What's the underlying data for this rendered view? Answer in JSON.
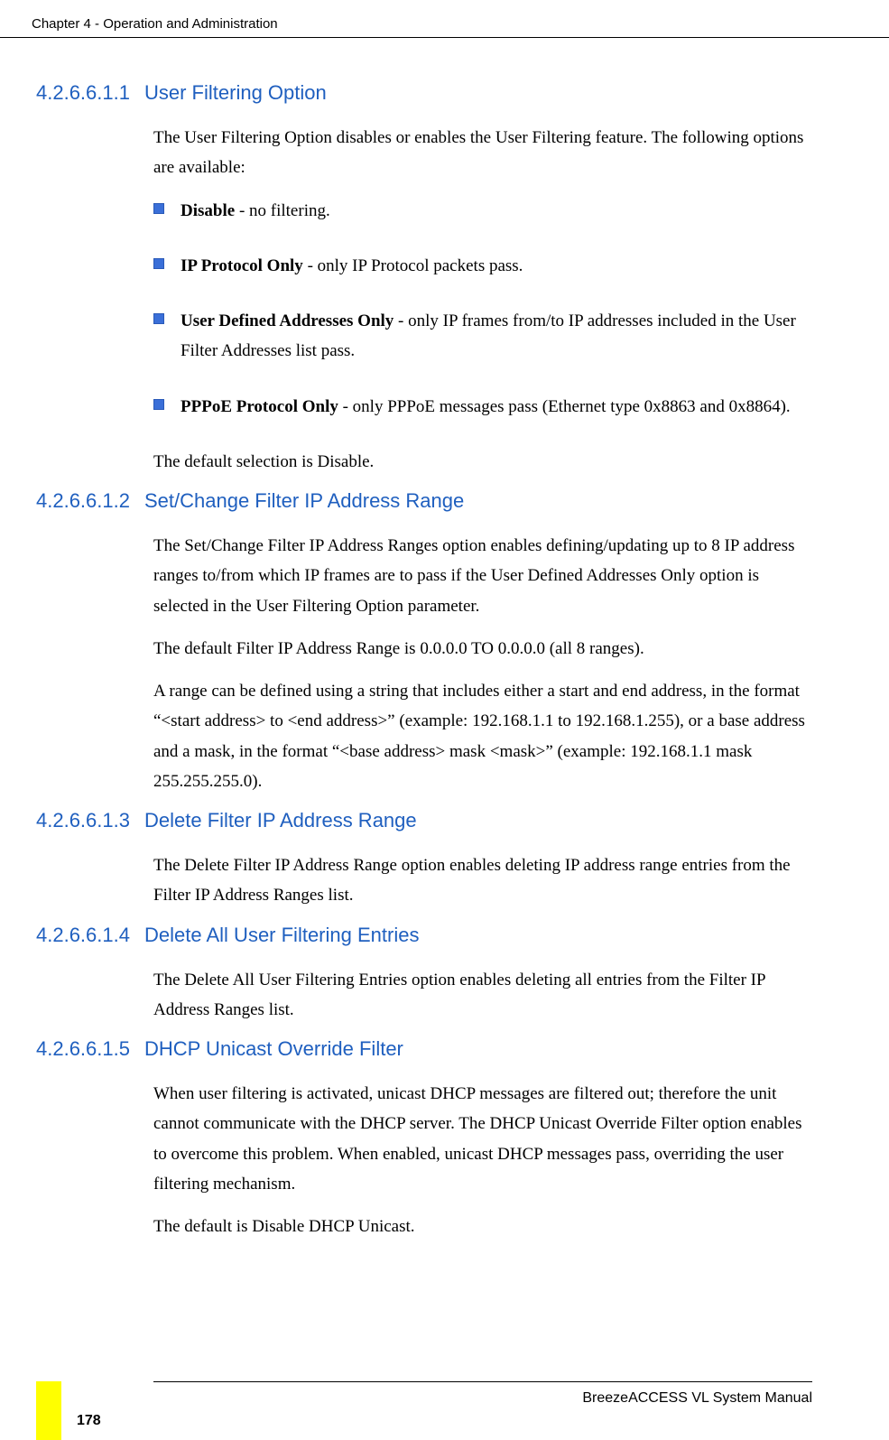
{
  "header": {
    "chapter": "Chapter 4 - Operation and Administration"
  },
  "sections": {
    "s1": {
      "number": "4.2.6.6.1.1",
      "title": "User Filtering Option",
      "intro": "The User Filtering Option disables or enables the User Filtering feature. The following options are available:",
      "bullet1_bold": "Disable",
      "bullet1_rest": " - no filtering.",
      "bullet2_bold": "IP Protocol Only",
      "bullet2_rest": " - only IP Protocol packets pass.",
      "bullet3_bold": "User Defined Addresses Only",
      "bullet3_rest": " - only IP frames from/to IP addresses included in the User Filter Addresses list pass.",
      "bullet4_bold": "PPPoE Protocol Only",
      "bullet4_rest": " - only PPPoE messages pass (Ethernet type 0x8863 and 0x8864).",
      "outro": "The default selection is Disable."
    },
    "s2": {
      "number": "4.2.6.6.1.2",
      "title": "Set/Change Filter IP Address Range",
      "p1": "The Set/Change Filter IP Address Ranges option enables defining/updating up to 8 IP address ranges to/from which IP frames are to pass if the User Defined Addresses Only option is selected in the User Filtering Option parameter.",
      "p2": "The default Filter IP Address Range is 0.0.0.0 TO 0.0.0.0 (all 8 ranges).",
      "p3": "A range can be defined using a string that includes either a start and end address, in the format “<start address> to <end address>” (example: 192.168.1.1 to 192.168.1.255), or a base address and a mask, in the format “<base address> mask <mask>” (example: 192.168.1.1 mask 255.255.255.0)."
    },
    "s3": {
      "number": "4.2.6.6.1.3",
      "title": "Delete Filter IP Address Range",
      "p1": "The Delete Filter IP Address Range option enables deleting IP address range entries from the Filter IP Address Ranges list."
    },
    "s4": {
      "number": "4.2.6.6.1.4",
      "title": "Delete All User Filtering Entries",
      "p1": "The Delete All User Filtering Entries option enables deleting all entries from the Filter IP Address Ranges list."
    },
    "s5": {
      "number": "4.2.6.6.1.5",
      "title": "DHCP Unicast Override Filter",
      "p1": "When user filtering is activated, unicast DHCP messages are filtered out; therefore the unit cannot communicate with the DHCP server. The DHCP Unicast Override Filter option enables to overcome this problem. When enabled, unicast DHCP messages pass, overriding the user filtering mechanism.",
      "p2": "The default is Disable DHCP Unicast."
    }
  },
  "footer": {
    "manual": "BreezeACCESS VL System Manual",
    "pagenum": "178"
  }
}
